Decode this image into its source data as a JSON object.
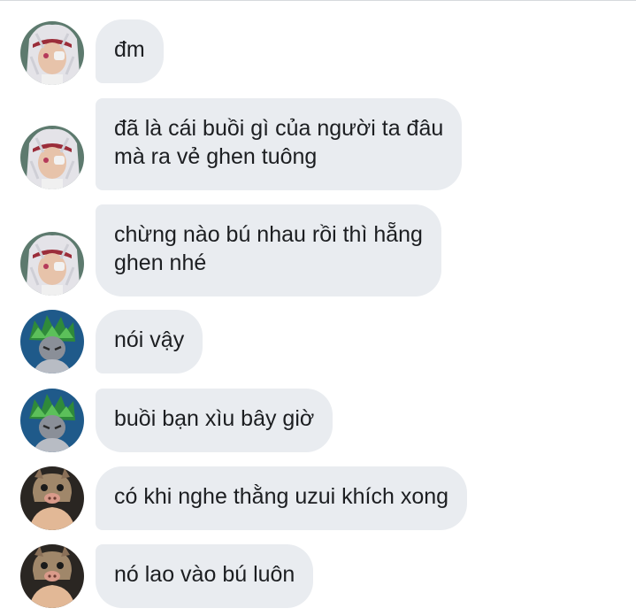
{
  "conversation": {
    "messages": [
      {
        "sender_avatar": "silver-haired-avatar-icon",
        "text": "đm"
      },
      {
        "sender_avatar": "silver-haired-avatar-icon",
        "text": "đã là cái buồi gì của người ta đâu\nmà ra vẻ ghen tuông"
      },
      {
        "sender_avatar": "silver-haired-avatar-icon",
        "text": "chừng nào bú nhau rồi thì hẵng\nghen nhé"
      },
      {
        "sender_avatar": "green-haired-avatar-icon",
        "text": "nói vậy"
      },
      {
        "sender_avatar": "green-haired-avatar-icon",
        "text": "buồi bạn xìu bây giờ"
      },
      {
        "sender_avatar": "boar-mask-avatar-icon",
        "text": "có khi nghe thằng uzui khích xong"
      },
      {
        "sender_avatar": "boar-mask-avatar-icon",
        "text": "nó lao vào bú luôn"
      }
    ]
  },
  "colors": {
    "bubble_bg": "#e9ecf0",
    "text": "#1c1e21",
    "background": "#ffffff"
  }
}
